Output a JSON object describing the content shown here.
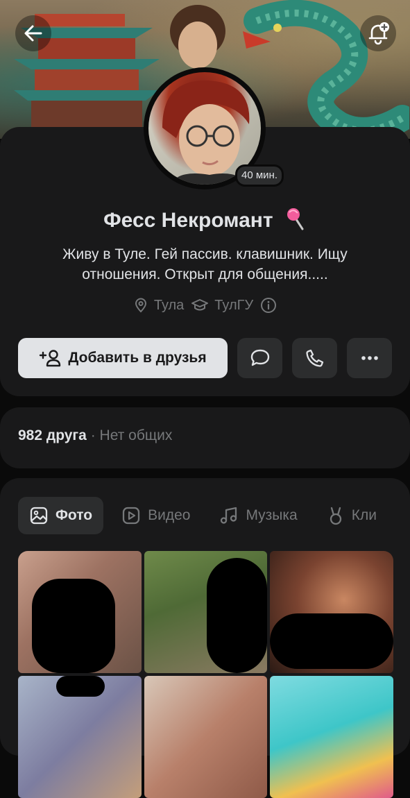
{
  "profile": {
    "name": "Фесс Некромант",
    "last_seen": "40 мин.",
    "status": "Живу в Туле. Гей пассив. клавишник. Ищу отношения. Открыт для общения.....",
    "city": "Тула",
    "education": "ТулГУ"
  },
  "actions": {
    "add_friend_label": "Добавить в друзья"
  },
  "friends": {
    "count": "982 друга",
    "separator": "·",
    "mutual": "Нет общих"
  },
  "tabs": [
    {
      "label": "Фото",
      "icon": "image-icon",
      "active": true
    },
    {
      "label": "Видео",
      "icon": "play-icon",
      "active": false
    },
    {
      "label": "Музыка",
      "icon": "music-note-icon",
      "active": false
    },
    {
      "label": "Кли",
      "icon": "clips-icon",
      "active": false
    }
  ],
  "colors": {
    "background": "#0a0a0a",
    "card": "#19191a",
    "button": "#2c2d2e",
    "primary_button": "#e1e3e6",
    "text": "#e1e3e6",
    "secondary_text": "#76787a"
  }
}
